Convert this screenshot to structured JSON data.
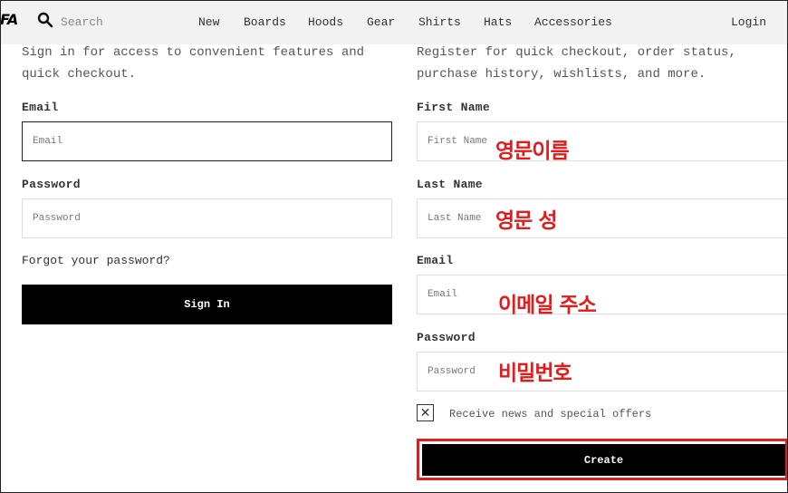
{
  "header": {
    "logo": "FA",
    "search_placeholder": "Search",
    "nav": [
      "New",
      "Boards",
      "Hoods",
      "Gear",
      "Shirts",
      "Hats",
      "Accessories"
    ],
    "login": "Login"
  },
  "signin": {
    "intro_line1": "Sign in for access to convenient features and",
    "intro_line2": "quick checkout.",
    "email_label": "Email",
    "email_placeholder": "Email",
    "password_label": "Password",
    "password_placeholder": "Password",
    "forgot": "Forgot your password?",
    "button": "Sign In"
  },
  "register": {
    "intro_line1": "Register for quick checkout, order status,",
    "intro_line2": "purchase history, wishlists, and more.",
    "first_name_label": "First Name",
    "first_name_placeholder": "First Name",
    "last_name_label": "Last Name",
    "last_name_placeholder": "Last Name",
    "email_label": "Email",
    "email_placeholder": "Email",
    "password_label": "Password",
    "password_placeholder": "Password",
    "newsletter_label": "Receive news and special offers",
    "newsletter_checked": true,
    "checkbox_mark": "✕",
    "button": "Create"
  },
  "annotations": {
    "first_name": "영문이름",
    "last_name": "영문 성",
    "email": "이메일 주소",
    "password": "비밀번호",
    "color": "#e21b1b"
  },
  "colors": {
    "header_bg": "#f2f2f2",
    "button_bg": "#000000",
    "highlight_border": "#e02020"
  }
}
